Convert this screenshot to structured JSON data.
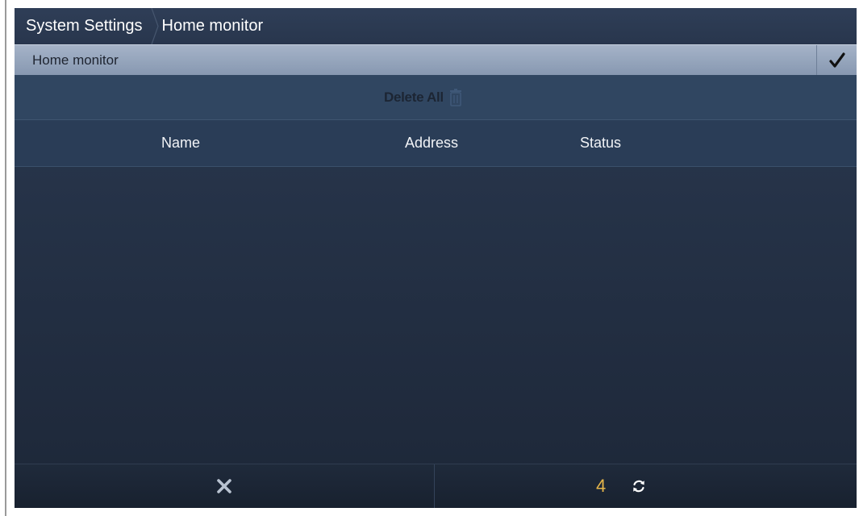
{
  "breadcrumb": {
    "root": "System Settings",
    "current": "Home monitor"
  },
  "titlebar": {
    "label": "Home monitor",
    "confirm_icon": "checkmark-icon"
  },
  "actions": {
    "delete_all_label": "Delete All",
    "delete_icon": "trash-icon"
  },
  "table": {
    "columns": [
      "Name",
      "Address",
      "Status"
    ],
    "rows": []
  },
  "footer": {
    "cancel_icon": "close-icon",
    "count": "4",
    "refresh_icon": "refresh-icon"
  },
  "colors": {
    "accent_count": "#e6b64a",
    "titlebar": "#97a7bd",
    "background": "#253247"
  }
}
